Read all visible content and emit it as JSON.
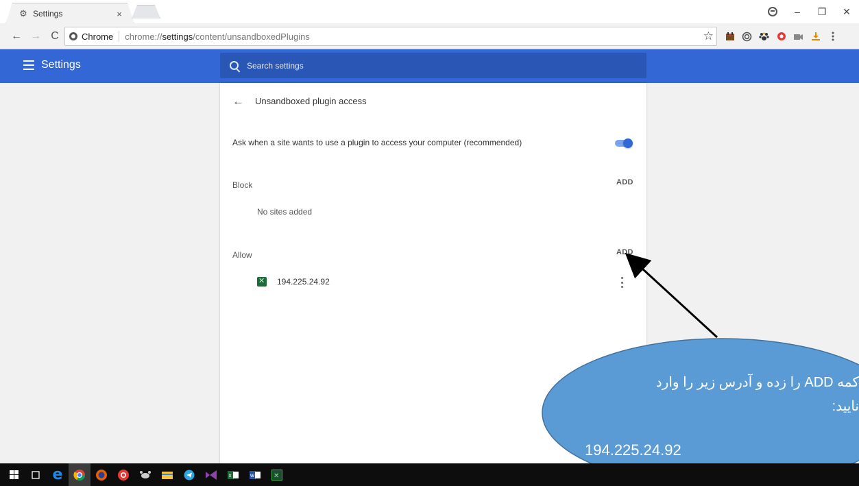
{
  "browser": {
    "tab_title": "Settings",
    "tab_close": "×",
    "omnibox": {
      "chip_label": "Chrome",
      "url_prefix": "chrome://",
      "url_host": "settings",
      "url_path": "/content/unsandboxedPlugins"
    },
    "window_controls": [
      "–",
      "❐",
      "✕"
    ]
  },
  "settings": {
    "header_title": "Settings",
    "search_placeholder": "Search settings",
    "page_title": "Unsandboxed plugin access",
    "ask_label": "Ask when a site wants to use a plugin to access your computer (recommended)",
    "ask_toggle_on": true,
    "block": {
      "label": "Block",
      "add_label": "ADD",
      "empty_message": "No sites added"
    },
    "allow": {
      "label": "Allow",
      "add_label": "ADD",
      "sites": [
        "194.225.24.92"
      ]
    }
  },
  "annotation": {
    "line1": "کمه ADD را زده و آدرس زیر را وارد",
    "line2": "نایید:",
    "ip": "194.225.24.92",
    "fill_color": "#5b9bd5",
    "stroke_color": "#41719c"
  },
  "colors": {
    "header_bg": "#3367d6",
    "toggle_on": "#3367d6",
    "taskbar_bg": "#0d0d0d"
  },
  "extensions": [
    "calendar-icon",
    "spiral-icon",
    "paw-icon",
    "record-icon",
    "video-icon",
    "download-icon",
    "menu-icon"
  ],
  "taskbar_items": [
    "windows-start-icon",
    "task-view-icon",
    "edge-icon",
    "chrome-icon",
    "firefox-icon",
    "opera-icon",
    "app-icon",
    "file-explorer-icon",
    "telegram-icon",
    "visual-studio-icon",
    "excel-icon",
    "word-icon",
    "green-app-icon"
  ]
}
